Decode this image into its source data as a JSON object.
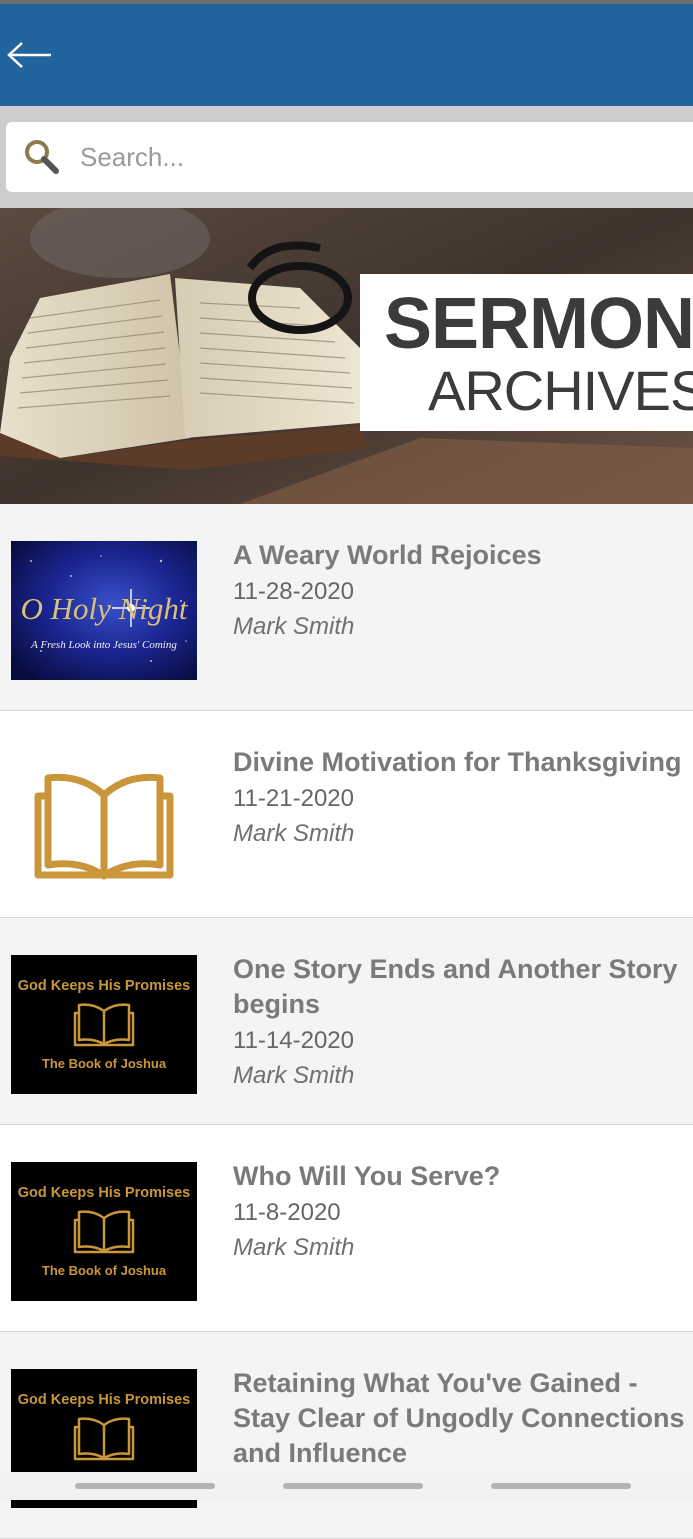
{
  "search": {
    "placeholder": "Search..."
  },
  "hero": {
    "line1": "SERMON",
    "line2": "ARCHIVES"
  },
  "thumbs": {
    "holy_night": {
      "line1": "O Holy Night",
      "line2": "A Fresh Look into Jesus' Coming"
    },
    "joshua": {
      "line1": "God Keeps His Promises",
      "line2": "The Book of Joshua"
    }
  },
  "sermons": [
    {
      "title": "A Weary World Rejoices",
      "date": "11-28-2020",
      "speaker": "Mark Smith"
    },
    {
      "title": "Divine Motivation for Thanksgiving",
      "date": "11-21-2020",
      "speaker": "Mark Smith"
    },
    {
      "title": "One Story Ends and Another Story begins",
      "date": "11-14-2020",
      "speaker": "Mark Smith"
    },
    {
      "title": "Who Will You Serve?",
      "date": "11-8-2020",
      "speaker": "Mark Smith"
    },
    {
      "title": "Retaining What You've Gained - Stay Clear of Ungodly Connections and Influence",
      "date": "",
      "speaker": ""
    }
  ],
  "colors": {
    "appbar": "#22649e",
    "gold": "#c9973a",
    "title_gray": "#7a7a7a"
  },
  "icons": {
    "back": "arrow-left-icon",
    "search": "search-icon",
    "book": "open-book-icon"
  }
}
